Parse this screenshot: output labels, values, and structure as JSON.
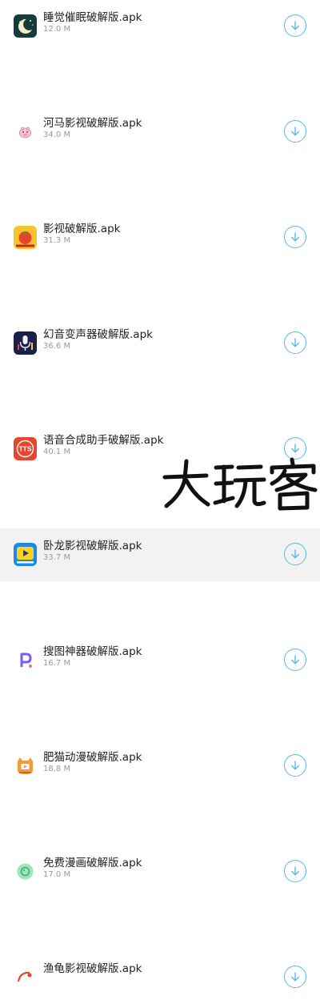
{
  "files": [
    {
      "name": "睡觉催眠破解版.apk",
      "size": "12.0 M",
      "icon": "moon-sleep-app-icon",
      "selected": false
    },
    {
      "name": "河马影视破解版.apk",
      "size": "34.0 M",
      "icon": "hippo-app-icon",
      "selected": false
    },
    {
      "name": "影视破解版.apk",
      "size": "31.3 M",
      "icon": "tomato-app-icon",
      "selected": false
    },
    {
      "name": "幻音变声器破解版.apk",
      "size": "36.6 M",
      "icon": "microphone-app-icon",
      "selected": false
    },
    {
      "name": "语音合成助手破解版.apk",
      "size": "40.1 M",
      "icon": "tts-app-icon",
      "selected": false
    },
    {
      "name": "卧龙影视破解版.apk",
      "size": "33.7 M",
      "icon": "play-app-icon",
      "selected": true
    },
    {
      "name": "搜图神器破解版.apk",
      "size": "16.7 M",
      "icon": "letter-p-app-icon",
      "selected": false
    },
    {
      "name": "肥猫动漫破解版.apk",
      "size": "18.8 M",
      "icon": "cat-app-icon",
      "selected": false
    },
    {
      "name": "免费漫画破解版.apk",
      "size": "17.0 M",
      "icon": "comic-app-icon",
      "selected": false
    },
    {
      "name": "渔龟影视破解版.apk",
      "size": "",
      "icon": "turtle-app-icon",
      "selected": false
    }
  ],
  "colors": {
    "accent": "#59b9f0",
    "selected_row": "#f2f2f2",
    "name_text": "#222222",
    "size_text": "#9a9a9a"
  },
  "download_icon": "download-arrow-icon",
  "watermark": {
    "icon": "watermark-logo",
    "text": "大玩客"
  }
}
